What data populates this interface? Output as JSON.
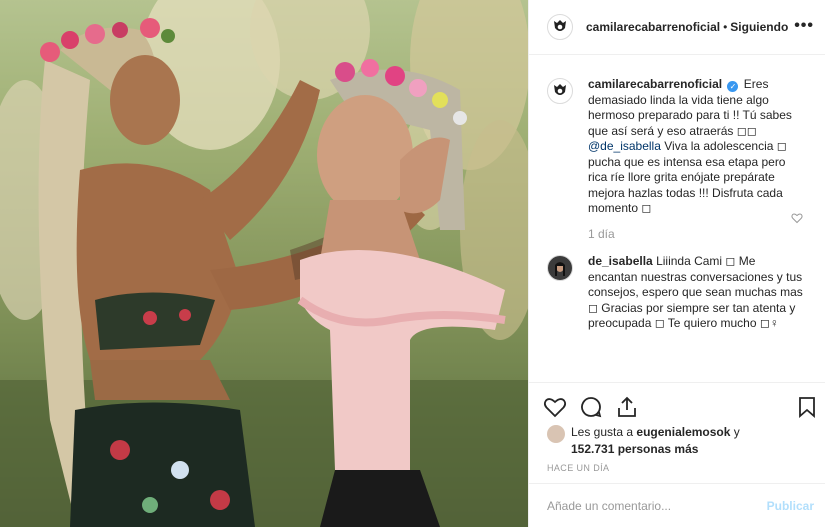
{
  "photo": {
    "alt": "Two women, one placing a flower crown on the other"
  },
  "header": {
    "username": "camilarecabarrenoficial",
    "separator": "•",
    "follow_status": "Siguiendo",
    "more_label": "•••"
  },
  "caption": {
    "username": "camilarecabarrenoficial",
    "verified_mark": "✓",
    "text_part1": "Eres demasiado linda la vida tiene algo hermoso preparado para ti !! Tú sabes que así será y eso atraerás ◻◻",
    "mention": "@de_isabella",
    "text_part2": "Viva la adolescencia ◻ pucha que es intensa esa etapa pero rica ríe llore grita enójate prepárate mejora hazlas todas !!! Disfruta cada momento ◻",
    "time": "1 día"
  },
  "reply": {
    "username": "de_isabella",
    "text": "Liiinda Cami ◻ Me encantan nuestras conversaciones y tus consejos, espero que sean muchas mas ◻ Gracias por siempre ser tan atenta y preocupada ◻ Te quiero mucho ◻♀"
  },
  "likes": {
    "prefix": "Les gusta a",
    "user": "eugenialemosok",
    "conj": "y",
    "count": "152.731 personas más"
  },
  "posted": "HACE UN DÍA",
  "add_comment": {
    "placeholder": "Añade un comentario...",
    "publish": "Publicar"
  },
  "colors": {
    "accent": "#3897f0",
    "publish_disabled": "#b2dffc",
    "muted": "#999999",
    "border": "#efefef"
  }
}
